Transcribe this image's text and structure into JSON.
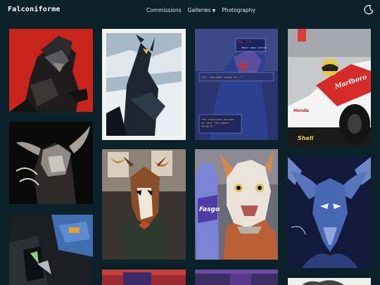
{
  "site": {
    "title": "Falconiforme"
  },
  "nav": {
    "commissions": "Commissions",
    "galleries": "Galleries",
    "photography": "Photography"
  },
  "icons": {
    "theme_toggle": "moon-icon",
    "galleries_dropdown": "chevron-down-icon"
  },
  "colors": {
    "background": "#0b2129",
    "nav_text": "#dfe9ec"
  },
  "artwork_text": {
    "comic_caption_1": "\"No, I'm",
    "comic_caption_2": "...Never been better",
    "comic_caption_3": "\"Oh, everyone loved it...\"",
    "comic_caption_4": "\"No suspicion arised\nto fact the death\nmiracle.\"",
    "car_sponsor": "Marlboro",
    "car_sponsor_2": "Shell",
    "car_sponsor_3": "Honda",
    "bottle_brand": "Fasgo"
  }
}
